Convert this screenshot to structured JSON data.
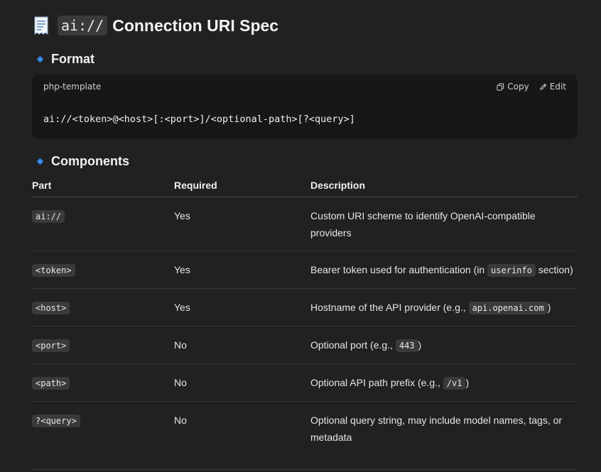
{
  "heading": {
    "emoji": "receipt-icon",
    "code": "ai://",
    "title": "Connection URI Spec"
  },
  "format_section": {
    "title": "Format",
    "code_block": {
      "language": "php-template",
      "copy_label": "Copy",
      "edit_label": "Edit",
      "code": "ai://<token>@<host>[:<port>]/<optional-path>[?<query>]"
    }
  },
  "components_section": {
    "title": "Components",
    "columns": [
      "Part",
      "Required",
      "Description"
    ],
    "rows": [
      {
        "part": "ai://",
        "required": "Yes",
        "description_before": "Custom URI scheme to identify OpenAI-compatible providers",
        "description_code": "",
        "description_after": ""
      },
      {
        "part": "<token>",
        "required": "Yes",
        "description_before": "Bearer token used for authentication (in ",
        "description_code": "userinfo",
        "description_after": " section)"
      },
      {
        "part": "<host>",
        "required": "Yes",
        "description_before": "Hostname of the API provider (e.g., ",
        "description_code": "api.openai.com",
        "description_after": ")"
      },
      {
        "part": "<port>",
        "required": "No",
        "description_before": "Optional port (e.g., ",
        "description_code": "443",
        "description_after": ")"
      },
      {
        "part": "<path>",
        "required": "No",
        "description_before": "Optional API path prefix (e.g., ",
        "description_code": "/v1",
        "description_after": ")"
      },
      {
        "part": "?<query>",
        "required": "No",
        "description_before": "Optional query string, may include model names, tags, or metadata",
        "description_code": "",
        "description_after": ""
      }
    ]
  },
  "colors": {
    "background": "#212121",
    "code_block_bg": "#171717",
    "inline_code_bg": "#3a3a3a",
    "diamond_accent": "#3d8ef0"
  }
}
